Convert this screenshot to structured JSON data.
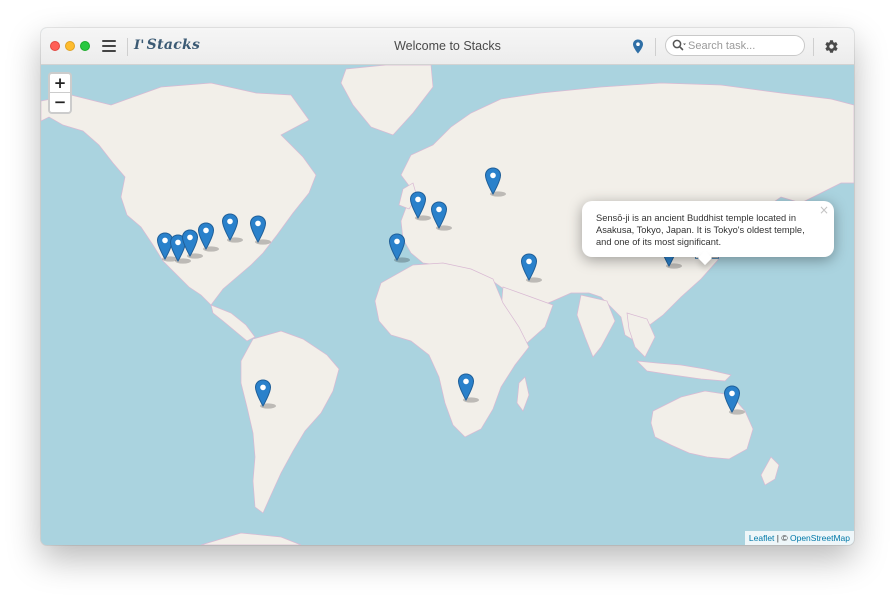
{
  "window": {
    "title": "Welcome to Stacks",
    "brand": "Stacks",
    "brand_mark": "I'"
  },
  "icons": {
    "menu": "hamburger-menu-icon",
    "location": "map-pin-icon",
    "search": "search-icon",
    "settings": "gear-icon"
  },
  "search": {
    "placeholder": "Search task..."
  },
  "zoom": {
    "in_label": "+",
    "out_label": "−"
  },
  "popup": {
    "text": "Sensō-ji is an ancient Buddhist temple located in Asakusa, Tokyo, Japan. It is Tokyo's oldest temple, and one of its most significant.",
    "close_label": "×"
  },
  "attribution": {
    "leaflet": "Leaflet",
    "separator": " | © ",
    "osm": "OpenStreetMap"
  },
  "colors": {
    "water": "#aad3df",
    "land": "#f2efe9",
    "marker": "#2a81cb",
    "accent": "#3b5a74"
  },
  "markers": [
    {
      "name": "marker-west-coast-1"
    },
    {
      "name": "marker-west-coast-2"
    },
    {
      "name": "marker-west-coast-3"
    },
    {
      "name": "marker-rockies"
    },
    {
      "name": "marker-midwest"
    },
    {
      "name": "marker-east-coast"
    },
    {
      "name": "marker-london"
    },
    {
      "name": "marker-central-europe"
    },
    {
      "name": "marker-moscow"
    },
    {
      "name": "marker-iberia"
    },
    {
      "name": "marker-gulf"
    },
    {
      "name": "marker-china"
    },
    {
      "name": "marker-tokyo"
    },
    {
      "name": "marker-chile"
    },
    {
      "name": "marker-south-africa"
    },
    {
      "name": "marker-australia"
    }
  ]
}
